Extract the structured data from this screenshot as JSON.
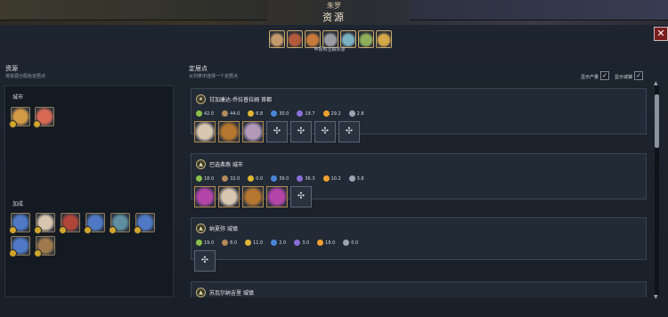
{
  "header": {
    "small_title": "朱罗",
    "title": "资源"
  },
  "colors": {
    "gold": "#caa86a",
    "card": "#222a35",
    "panel": "#1a2029",
    "close": "#7a1d1d"
  },
  "categories": [
    {
      "icon": "resource-icon-1",
      "color": "#c49a6c"
    },
    {
      "icon": "resource-icon-2",
      "color": "#b35b3a"
    },
    {
      "icon": "resource-icon-3",
      "color": "#c77b3a"
    },
    {
      "icon": "resource-icon-4",
      "color": "#9b9ba3"
    },
    {
      "icon": "resource-icon-5",
      "color": "#7cb1c2"
    },
    {
      "icon": "resource-icon-6",
      "color": "#8fae5a"
    },
    {
      "icon": "resource-icon-7",
      "color": "#d6a84a"
    }
  ],
  "categories_caption": "申报和宝藏资源",
  "left": {
    "title": "资源",
    "subtitle": "将资源分配给定居点",
    "city_label": "城市",
    "bonus_label": "加成",
    "city_items": [
      {
        "icon": "tea-icon",
        "color": "#d49b45"
      },
      {
        "icon": "cake-icon",
        "color": "#d86a55"
      }
    ],
    "bonus_items": [
      {
        "icon": "grain-icon-1",
        "color": "#4f79c4"
      },
      {
        "icon": "cake-icon-2",
        "color": "#d9c6b0"
      },
      {
        "icon": "brick-icon",
        "color": "#b0463a"
      },
      {
        "icon": "grain-icon-2",
        "color": "#4f79c4"
      },
      {
        "icon": "ship-icon",
        "color": "#5f8ea0"
      },
      {
        "icon": "grain-icon-3",
        "color": "#4f79c4"
      },
      {
        "icon": "grain-icon-4",
        "color": "#4f79c4"
      },
      {
        "icon": "cannon-icon",
        "color": "#a07a4c"
      }
    ]
  },
  "right": {
    "title": "定居点",
    "subtitle": "从列表中选择一个定居点",
    "show_output_label": "显示产量",
    "show_city_label": "显示城镇",
    "show_output_checked": "✓",
    "show_city_checked": "✓"
  },
  "settlements": [
    {
      "name": "甘加康达-乔拉普拉姆 首都",
      "yields": [
        "42.0",
        "44.0",
        "6.8",
        "30.0",
        "19.7",
        "29.2",
        "2.8"
      ],
      "slots_filled": [
        {
          "icon": "cake-slot-icon",
          "color": "#d9c6b0"
        },
        {
          "icon": "shield-slot-icon",
          "color": "#b5762f"
        },
        {
          "icon": "grain-slot-icon",
          "color": "#b39ab9"
        }
      ],
      "empty_slots": 4
    },
    {
      "name": "巴选弗燕 城市",
      "yields": [
        "18.0",
        "32.0",
        "0.0",
        "39.0",
        "36.3",
        "10.2",
        "3.8"
      ],
      "slots_filled": [
        {
          "icon": "magenta-slot-icon",
          "color": "#b344a8"
        },
        {
          "icon": "cake-slot-icon-2",
          "color": "#d9c6b0"
        },
        {
          "icon": "shield-slot-icon-2",
          "color": "#b5762f"
        },
        {
          "icon": "magenta-slot-icon-2",
          "color": "#b344a8"
        }
      ],
      "empty_slots": 1
    },
    {
      "name": "纳夏弥 城镇",
      "yields": [
        "19.0",
        "8.0",
        "11.0",
        "2.0",
        "3.0",
        "18.0",
        "0.0"
      ],
      "slots_filled": [],
      "empty_slots": 1
    },
    {
      "name": "苏瓦尔纳吉里 城镇",
      "yields": [],
      "slots_filled": [],
      "empty_slots": 0
    }
  ],
  "yield_icons": [
    {
      "name": "food-icon",
      "color": "#8cc04a"
    },
    {
      "name": "production-icon",
      "color": "#b48a5a"
    },
    {
      "name": "gold-icon",
      "color": "#e0b634"
    },
    {
      "name": "science-icon",
      "color": "#4a86d6"
    },
    {
      "name": "culture-icon",
      "color": "#8a6fd8"
    },
    {
      "name": "happiness-icon",
      "color": "#f0a030"
    },
    {
      "name": "influence-icon",
      "color": "#9aa6b2"
    }
  ]
}
